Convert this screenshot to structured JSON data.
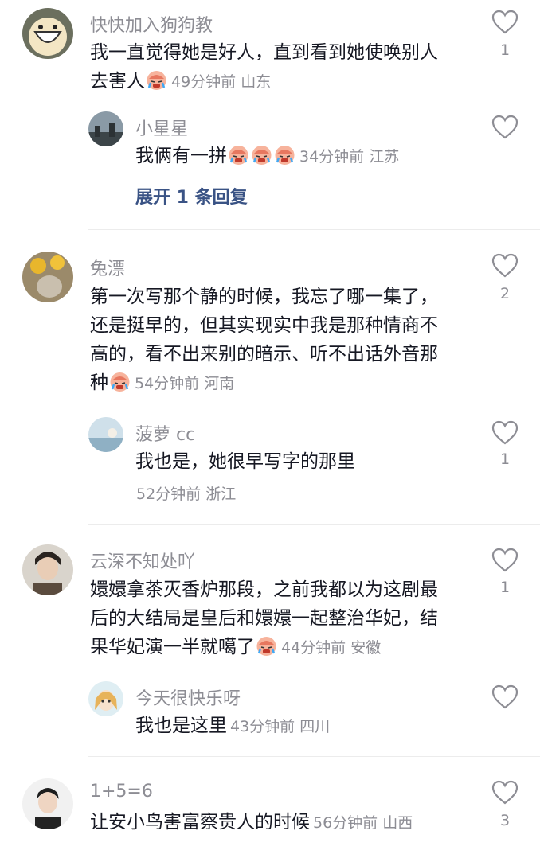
{
  "comments": [
    {
      "name": "快快加入狗狗教",
      "text_lines": [
        "我一直觉得她是好人，直到看到她使唤别人",
        "去害人"
      ],
      "emoji_count": 1,
      "meta": "49分钟前 山东",
      "likes": "1",
      "replies": [
        {
          "name": "小星星",
          "text": "我俩有一拼",
          "emoji_count": 3,
          "meta": "34分钟前 江苏",
          "likes": ""
        }
      ],
      "expand_label": "展开 1 条回复"
    },
    {
      "name": "兔漂",
      "text_lines": [
        "第一次写那个静的时候，我忘了哪一集了，",
        "还是挺早的，但其实现实中我是那种情商不",
        "高的，看不出来别的暗示、听不出话外音那",
        "种"
      ],
      "emoji_count": 1,
      "meta": "54分钟前 河南",
      "likes": "2",
      "replies": [
        {
          "name": "菠萝 cc",
          "text": "我也是，她很早写字的那里",
          "emoji_count": 0,
          "meta": "52分钟前 浙江",
          "likes": "1"
        }
      ]
    },
    {
      "name": "云深不知处吖",
      "text_lines": [
        "嬛嬛拿茶灭香炉那段，之前我都以为这剧最",
        "后的大结局是皇后和嬛嬛一起整治华妃，结",
        "果华妃演一半就噶了"
      ],
      "emoji_count": 1,
      "meta": "44分钟前 安徽",
      "likes": "1",
      "replies": [
        {
          "name": "今天很快乐呀",
          "text": "我也是这里",
          "emoji_count": 0,
          "meta": "43分钟前 四川",
          "likes": ""
        }
      ]
    },
    {
      "name": "1+5=6",
      "text_lines": [
        "让安小鸟害富察贵人的时候"
      ],
      "emoji_count": 0,
      "meta": "56分钟前 山西",
      "likes": "3"
    }
  ],
  "icons": {
    "like": "heart-outline-icon",
    "emoji": "crying-face-emoji"
  },
  "colors": {
    "text": "#161823",
    "muted": "#8d8d94",
    "link": "#3a5385"
  }
}
